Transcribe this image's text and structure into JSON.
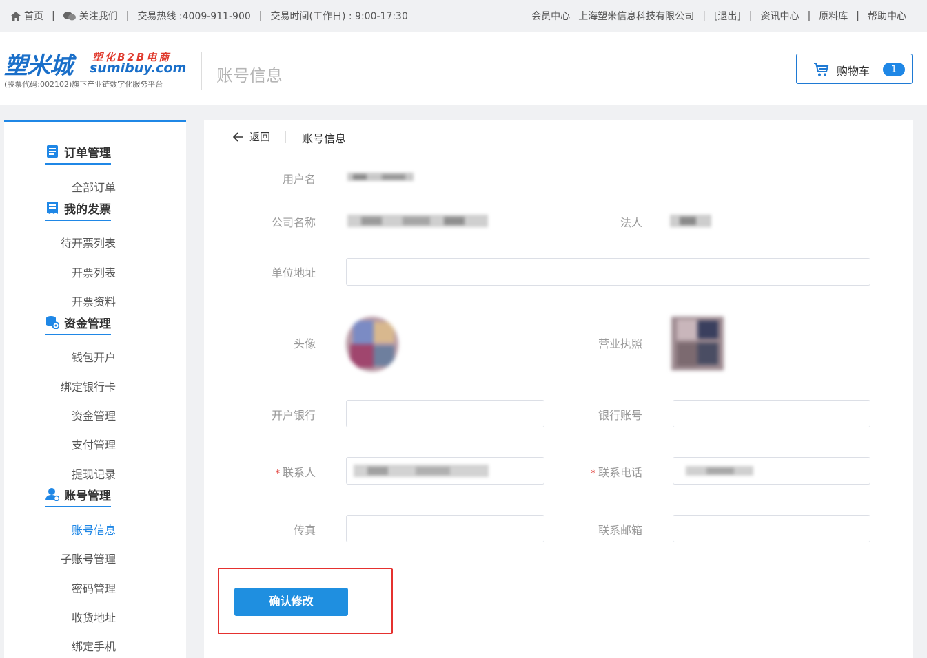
{
  "topbar": {
    "home": "首页",
    "follow": "关注我们",
    "hotline": "交易热线 :4009-911-900",
    "hours": "交易时间(工作日) : 9:00-17:30",
    "member_center": "会员中心",
    "company": "上海塑米信息科技有限公司",
    "logout": "[退出]",
    "news": "资讯中心",
    "materials": "原料库",
    "help": "帮助中心"
  },
  "header": {
    "logo_cn": "塑米城",
    "logo_tag": "塑化B2B电商",
    "logo_en": "sumibuy.com",
    "logo_sub": "(股票代码:002102)旗下产业链数字化服务平台",
    "page_title": "账号信息",
    "cart_label": "购物车",
    "cart_count": "1"
  },
  "sidebar": {
    "groups": [
      {
        "label": "订单管理",
        "icon": "order-icon",
        "items": [
          "全部订单"
        ]
      },
      {
        "label": "我的发票",
        "icon": "invoice-icon",
        "items": [
          "待开票列表",
          "开票列表",
          "开票资料"
        ]
      },
      {
        "label": "资金管理",
        "icon": "funds-icon",
        "items": [
          "钱包开户",
          "绑定银行卡",
          "资金管理",
          "支付管理",
          "提现记录"
        ]
      },
      {
        "label": "账号管理",
        "icon": "account-icon",
        "items": [
          "账号信息",
          "子账号管理",
          "密码管理",
          "收货地址",
          "绑定手机"
        ]
      }
    ],
    "active_item": "账号信息"
  },
  "main": {
    "back_label": "返回",
    "crumb_title": "账号信息",
    "fields": {
      "username": "用户名",
      "company_name": "公司名称",
      "legal_person": "法人",
      "address": "单位地址",
      "avatar": "头像",
      "license": "营业执照",
      "bank": "开户银行",
      "bank_account": "银行账号",
      "contact": "联系人",
      "phone": "联系电话",
      "fax": "传真",
      "email": "联系邮箱"
    },
    "required_mark": "*",
    "confirm_button": "确认修改"
  },
  "colors": {
    "accent": "#1f87e6",
    "highlight": "#e5312f"
  }
}
